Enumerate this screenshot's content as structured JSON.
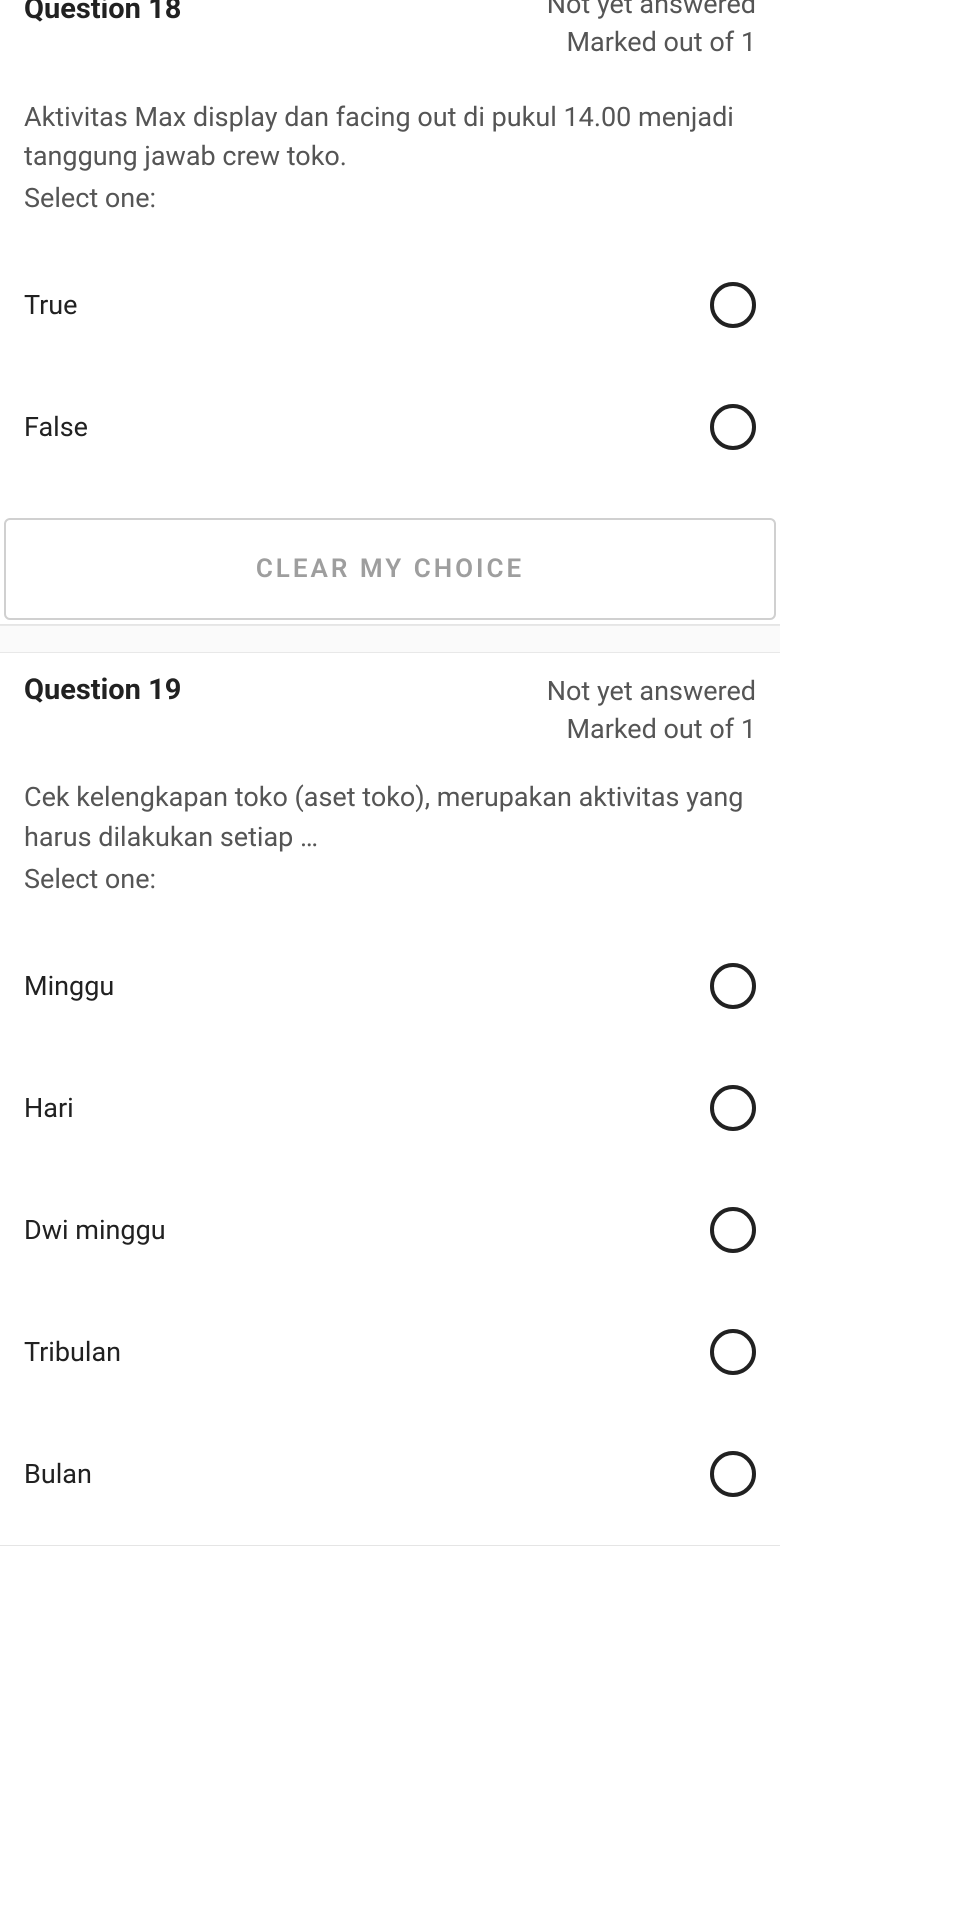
{
  "q18": {
    "title": "Question 18",
    "status": "Not yet answered",
    "marks": "Marked out of 1",
    "prompt": "Aktivitas Max display dan facing out di pukul 14.00 menjadi tanggung jawab crew toko.",
    "select_one": "Select one:",
    "options": [
      "True",
      "False"
    ],
    "clear_label": "CLEAR MY CHOICE"
  },
  "q19": {
    "title": "Question 19",
    "status": "Not yet answered",
    "marks": "Marked out of 1",
    "prompt": "Cek kelengkapan toko (aset toko), merupakan aktivitas yang harus dilakukan setiap …",
    "select_one": "Select one:",
    "options": [
      "Minggu",
      "Hari",
      "Dwi minggu",
      "Tribulan",
      "Bulan"
    ]
  }
}
